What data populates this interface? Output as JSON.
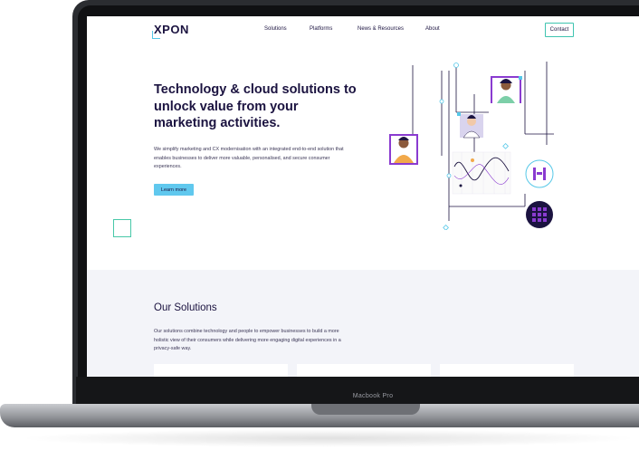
{
  "site": {
    "logo": "XPON",
    "nav": [
      "Solutions",
      "Platforms",
      "News & Resources",
      "About"
    ],
    "contact": "Contact"
  },
  "hero": {
    "title": "Technology & cloud solutions to unlock value from your marketing activities.",
    "text": "We simplify marketing and CX modernisation with an integrated end-to-end solution that enables businesses to deliver more valuable, personalised, and secure consumer experiences.",
    "cta": "Learn more"
  },
  "solutions": {
    "title": "Our Solutions",
    "text": "Our solutions combine technology and people to empower businesses to build a more holistic view of their consumers while delivering more engaging digital experiences in a privacy-safe way."
  },
  "device": {
    "label": "Macbook Pro"
  },
  "colors": {
    "navy": "#1b1340",
    "accent_blue": "#60c8ee",
    "accent_teal": "#48c8a8",
    "purple": "#8a3bd0"
  }
}
